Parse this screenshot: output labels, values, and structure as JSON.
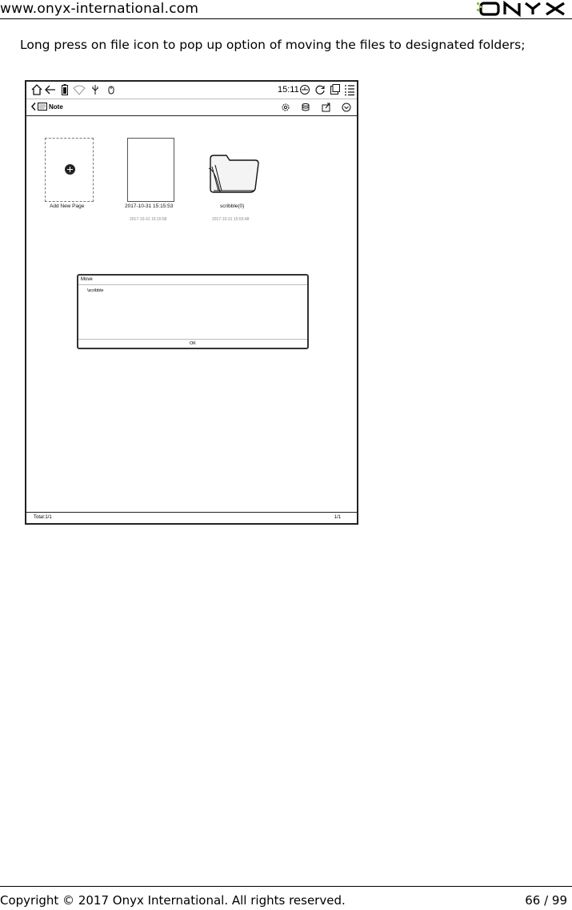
{
  "header": {
    "site_url": "www.onyx-international.com",
    "logo_text": "ONYX",
    "logo_accent_color": "#8bc34a"
  },
  "instruction": "Long press on file icon to pop up option of moving the files to designated folders;",
  "device": {
    "status_bar": {
      "time": "15:11",
      "icons": [
        "home-icon",
        "back-arrow-icon",
        "battery-icon",
        "wifi-icon",
        "usb-icon",
        "touch-icon",
        "clock-icon",
        "refresh-icon",
        "screen-icon",
        "menu-list-icon"
      ]
    },
    "title_bar": {
      "title": "Note",
      "icons": [
        "settings-icon",
        "database-icon",
        "export-icon",
        "dropdown-icon"
      ]
    },
    "items": [
      {
        "label": "Add New Page",
        "sublabel": ""
      },
      {
        "label": "2017-10-31 15:15:53",
        "sublabel": "2017-10-31 15:15:58"
      },
      {
        "label": "scribble(0)",
        "sublabel": "2017-10-31 15:55:48"
      }
    ],
    "dialog": {
      "title": "Move",
      "path": "\\scribble",
      "ok_label": "OK"
    },
    "bottom_bar": {
      "total": "Total:1/1",
      "pager": "1/1"
    }
  },
  "footer": {
    "copyright": "Copyright © 2017 Onyx International. All rights reserved.",
    "page_number": "66 / 99"
  }
}
